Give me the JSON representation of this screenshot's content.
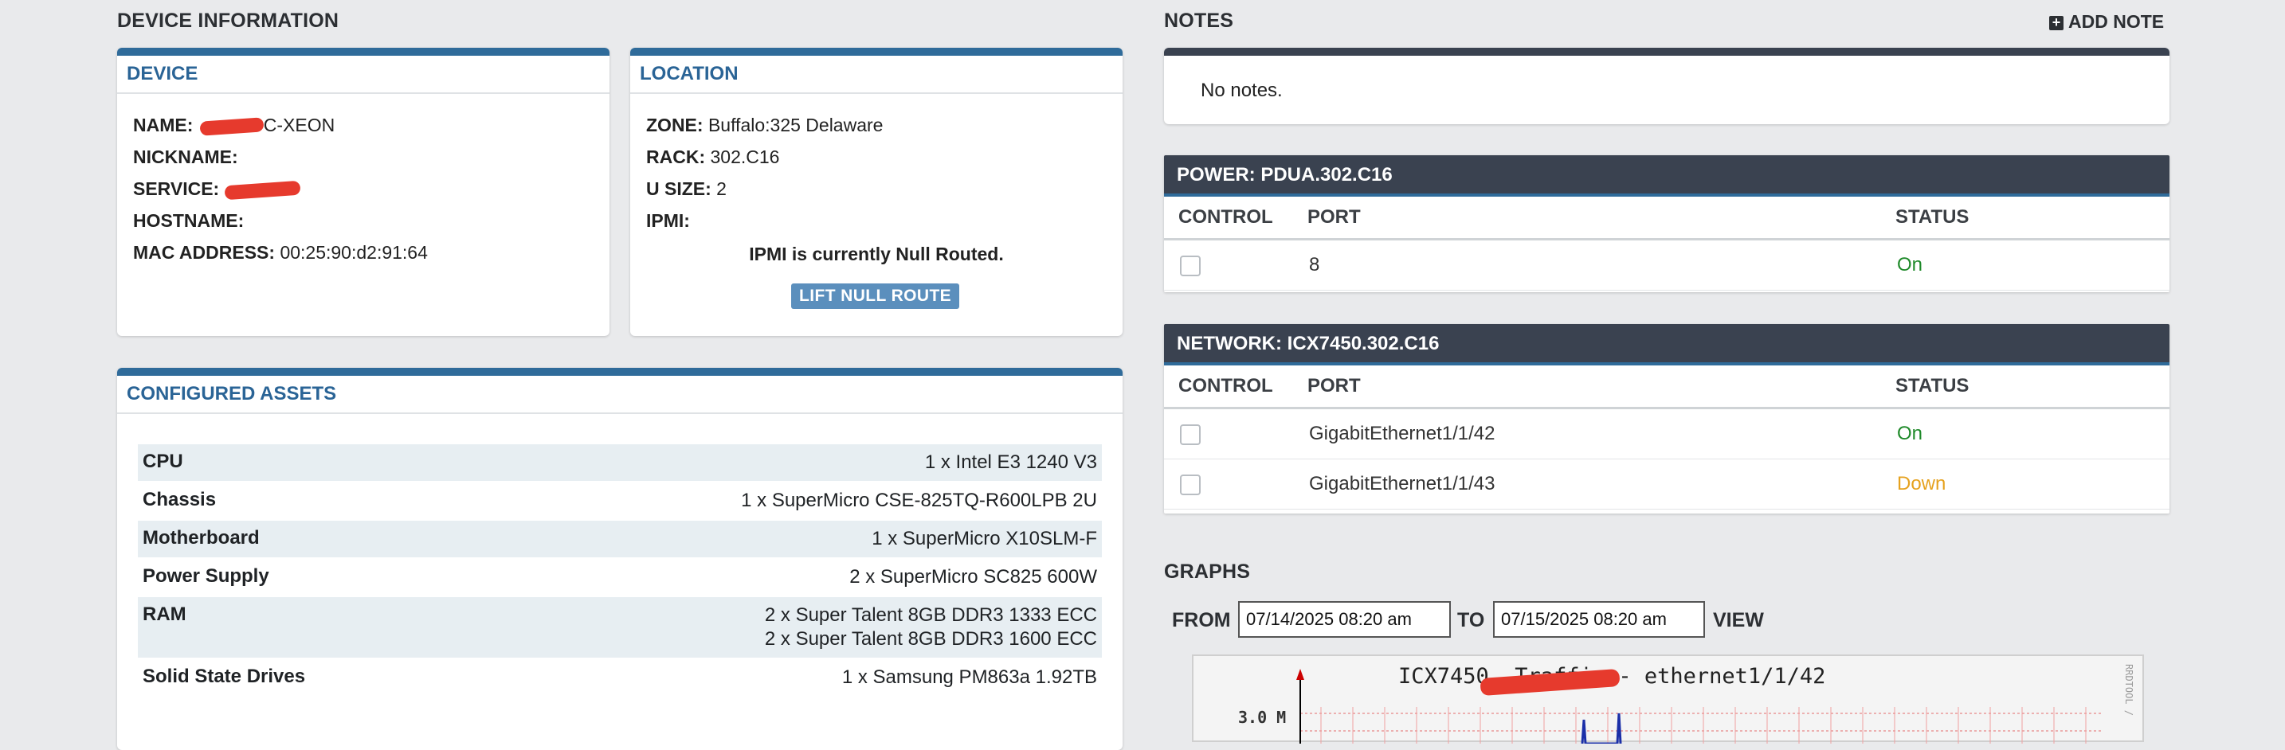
{
  "sections": {
    "device_information": "DEVICE INFORMATION",
    "notes": "NOTES",
    "graphs": "GRAPHS"
  },
  "device": {
    "title": "DEVICE",
    "fields": [
      {
        "label": "NAME:",
        "value": "C-XEON"
      },
      {
        "label": "NICKNAME:",
        "value": ""
      },
      {
        "label": "SERVICE:",
        "value": ""
      },
      {
        "label": "HOSTNAME:",
        "value": ""
      },
      {
        "label": "MAC ADDRESS:",
        "value": "00:25:90:d2:91:64"
      }
    ]
  },
  "location": {
    "title": "LOCATION",
    "fields": [
      {
        "label": "ZONE:",
        "value": "Buffalo:325 Delaware"
      },
      {
        "label": "RACK:",
        "value": "302.C16"
      },
      {
        "label": "U SIZE:",
        "value": "2"
      },
      {
        "label": "IPMI:",
        "value": ""
      }
    ],
    "ipmi_message": "IPMI is currently Null Routed.",
    "lift_button": "LIFT NULL ROUTE"
  },
  "assets": {
    "title": "CONFIGURED ASSETS",
    "rows": [
      {
        "k": "CPU",
        "v": [
          "1 x Intel E3 1240 V3"
        ]
      },
      {
        "k": "Chassis",
        "v": [
          "1 x SuperMicro CSE-825TQ-R600LPB 2U"
        ]
      },
      {
        "k": "Motherboard",
        "v": [
          "1 x SuperMicro X10SLM-F"
        ]
      },
      {
        "k": "Power Supply",
        "v": [
          "2 x SuperMicro SC825 600W"
        ]
      },
      {
        "k": "RAM",
        "v": [
          "2 x Super Talent 8GB DDR3 1333 ECC",
          "2 x Super Talent 8GB DDR3 1600 ECC"
        ]
      },
      {
        "k": "Solid State Drives",
        "v": [
          "1 x Samsung PM863a 1.92TB"
        ]
      }
    ]
  },
  "notes": {
    "add_label": "ADD NOTE",
    "empty": "No notes."
  },
  "power": {
    "title": "POWER: PDUA.302.C16",
    "headers": [
      "CONTROL",
      "PORT",
      "STATUS"
    ],
    "rows": [
      {
        "port": "8",
        "status": "On"
      }
    ]
  },
  "network": {
    "title": "NETWORK: ICX7450.302.C16",
    "headers": [
      "CONTROL",
      "PORT",
      "STATUS"
    ],
    "rows": [
      {
        "port": "GigabitEthernet1/1/42",
        "status": "On"
      },
      {
        "port": "GigabitEthernet1/1/43",
        "status": "Down"
      }
    ]
  },
  "graphs": {
    "from_label": "FROM",
    "to_label": "TO",
    "view_label": "VIEW",
    "from_value": "07/14/2025 08:20 am",
    "to_value": "07/15/2025 08:20 am",
    "graph_title": "ICX7450.     Traffic - ethernet1/1/42",
    "y_tick": "3.0 M",
    "side_label": "RRDTOOL /"
  },
  "colors": {
    "accent": "#2f6b9a",
    "on": "#1f8a2a",
    "down": "#e6a21f"
  }
}
